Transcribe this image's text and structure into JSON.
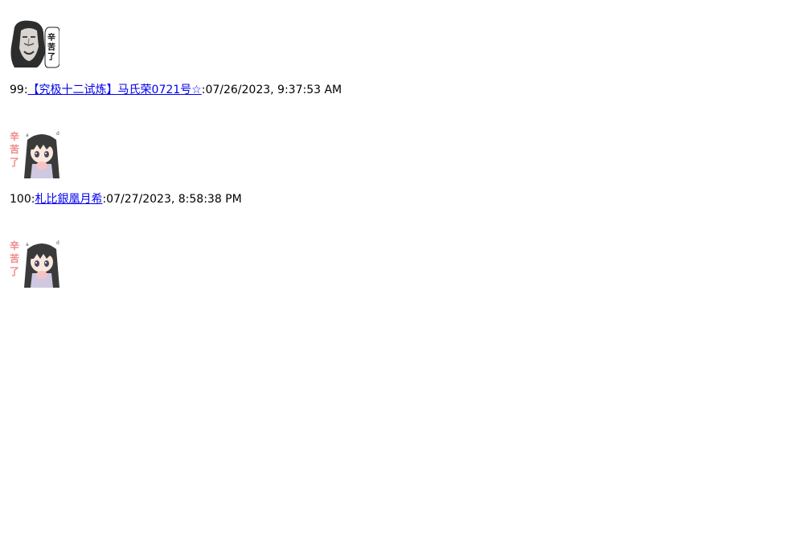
{
  "posts": [
    {
      "number": "99",
      "separator": ":",
      "author": "【究极十二试炼】马氏荣0721号☆",
      "date_separator": ":",
      "timestamp": "07/26/2023, 9:37:53 AM",
      "image": {
        "icon": "long-hair-man-sticker-icon",
        "caption_line1": "辛",
        "caption_line2": "苦",
        "caption_line3": "了"
      }
    },
    {
      "number": "100",
      "separator": ":",
      "author": "札比銀凰月希",
      "date_separator": ":",
      "timestamp": "07/27/2023, 8:58:38 PM",
      "image": {
        "icon": "anime-girl-sticker-icon",
        "caption_line1": "辛",
        "caption_line2": "苦",
        "caption_line3": "了"
      }
    }
  ],
  "top_image": {
    "icon": "anime-girl-sticker-icon",
    "caption_line1": "辛",
    "caption_line2": "苦",
    "caption_line3": "了"
  },
  "colors": {
    "link": "#0000ee",
    "sticker_text_pink": "#f08a8a",
    "hair_dark": "#3a3a3a",
    "skin": "#fbe8dc"
  }
}
